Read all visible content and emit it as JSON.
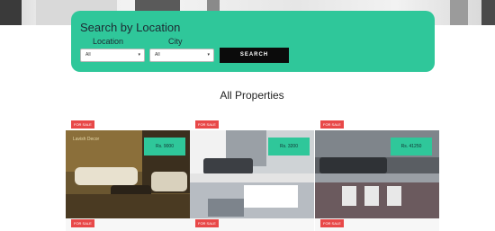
{
  "search": {
    "title": "Search by Location",
    "location_label": "Location",
    "city_label": "City",
    "location_value": "All",
    "city_value": "All",
    "button_label": "SEARCH"
  },
  "section_title": "All Properties",
  "properties": [
    {
      "badge": "FOR SALE",
      "price": "Rs. 9000",
      "tag": "Lavish Decor"
    },
    {
      "badge": "FOR SALE",
      "price": "Rs. 3200"
    },
    {
      "badge": "FOR SALE",
      "price": "Rs. 41250"
    }
  ],
  "second_row_badges": [
    "FOR SALE",
    "FOR SALE",
    "FOR SALE"
  ],
  "colors": {
    "accent": "#2fc79a",
    "badge": "#e84848",
    "button": "#0b0b0b"
  }
}
